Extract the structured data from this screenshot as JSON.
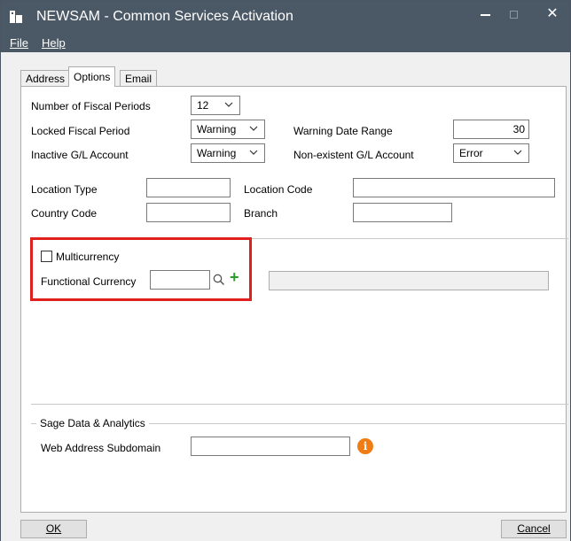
{
  "window": {
    "title": "NEWSAM - Common Services Activation",
    "minimize_glyph": "",
    "maximize_glyph": "",
    "close_glyph": "✕"
  },
  "menu": {
    "file": "File",
    "help": "Help"
  },
  "tabs": [
    {
      "label": "Address"
    },
    {
      "label": "Options",
      "active": true
    },
    {
      "label": "Email"
    }
  ],
  "options": {
    "fiscal_periods_label": "Number of Fiscal Periods",
    "fiscal_periods_value": "12",
    "locked_period_label": "Locked Fiscal Period",
    "locked_period_value": "Warning",
    "warning_range_label": "Warning Date Range",
    "warning_range_value": "30",
    "inactive_account_label": "Inactive G/L Account",
    "inactive_account_value": "Warning",
    "nonexistent_account_label": "Non-existent G/L Account",
    "nonexistent_account_value": "Error",
    "location_type_label": "Location Type",
    "location_type_value": "",
    "location_code_label": "Location Code",
    "location_code_value": "",
    "country_code_label": "Country Code",
    "country_code_value": "",
    "branch_label": "Branch",
    "branch_value": ""
  },
  "multicurrency": {
    "checkbox_label": "Multicurrency",
    "checked": false,
    "functional_currency_label": "Functional Currency",
    "functional_currency_value": "",
    "description_value": "",
    "plus_glyph": "+"
  },
  "sage": {
    "legend": "Sage Data & Analytics",
    "subdomain_label": "Web Address Subdomain",
    "subdomain_value": "",
    "info_glyph": "i"
  },
  "buttons": {
    "ok": "OK",
    "cancel": "Cancel"
  },
  "colors": {
    "titlebar": "#4b5866",
    "highlight": "#e0201c",
    "add_icon": "#2e9a2e",
    "info_icon": "#f07c15"
  }
}
